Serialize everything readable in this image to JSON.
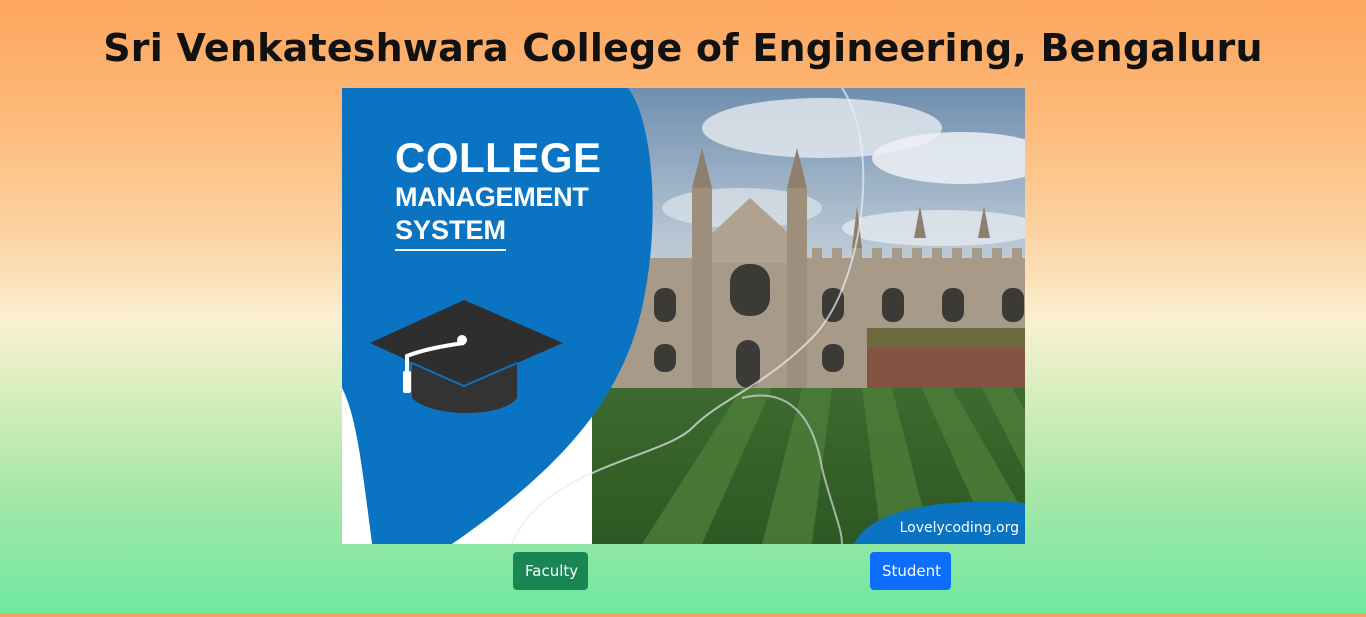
{
  "page": {
    "title": "Sri Venkateshwara College of Engineering, Bengaluru"
  },
  "hero": {
    "heading_line1": "COLLEGE",
    "heading_line2": "MANAGEMENT",
    "heading_line3": "SYSTEM",
    "watermark": "Lovelycoding.org"
  },
  "actions": {
    "faculty_label": "Faculty",
    "student_label": "Student"
  },
  "colors": {
    "faculty_button": "#198754",
    "student_button": "#0d6efd",
    "hero_blue": "#0a74c2"
  }
}
